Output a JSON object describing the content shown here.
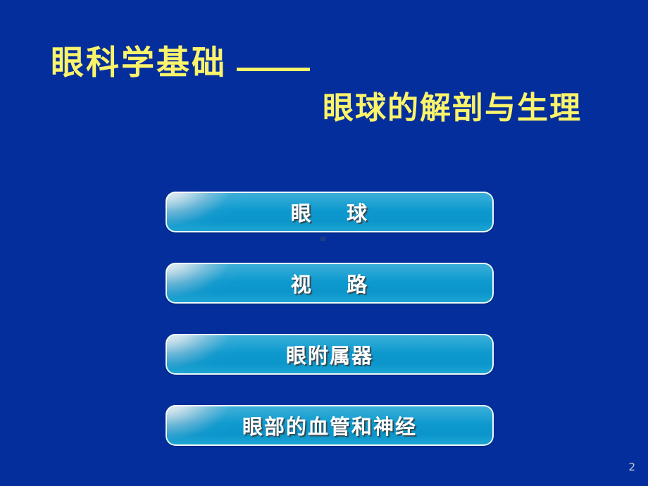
{
  "slide": {
    "background_color": "#042E9B",
    "accent_color": "#FBF46B",
    "button_color": "#0E9ACF"
  },
  "title": {
    "line1": "眼科学基础",
    "dash": "——",
    "line2": "眼球的解剖与生理"
  },
  "menu": {
    "items": [
      {
        "label": "眼    球"
      },
      {
        "label": "视    路"
      },
      {
        "label": "眼附属器"
      },
      {
        "label": "眼部的血管和神经"
      }
    ]
  },
  "footer": {
    "page_number": "2"
  }
}
